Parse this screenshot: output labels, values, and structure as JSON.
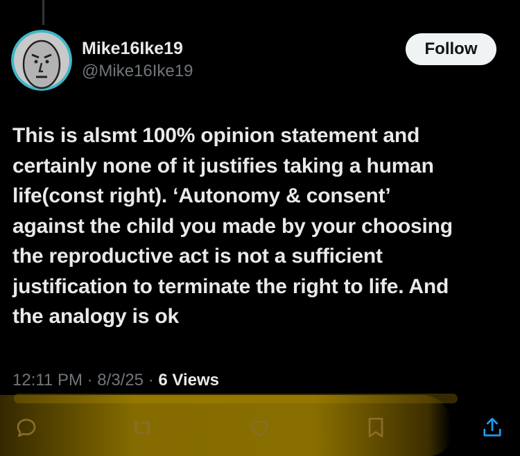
{
  "author": {
    "display_name": "Mike16Ike19",
    "handle": "@Mike16Ike19"
  },
  "follow_button": {
    "label": "Follow"
  },
  "post": {
    "text_lines": [
      "This is alsmt 100% opinion statement and",
      "certainly none of it justifies taking a human",
      "life(const right). ‘Autonomy & consent’",
      "against the child you made by your choosing",
      "the reproductive act is not a sufficient",
      "justification to terminate the right to life. And",
      "the analogy is ok"
    ]
  },
  "meta": {
    "time": "12:11 PM",
    "separator": "·",
    "date": "8/3/25",
    "views_count": "6",
    "views_label": "Views"
  },
  "actions": [
    {
      "name": "reply",
      "icon": "reply-icon"
    },
    {
      "name": "repost",
      "icon": "repost-icon"
    },
    {
      "name": "like",
      "icon": "heart-icon"
    },
    {
      "name": "bookmark",
      "icon": "bookmark-icon"
    },
    {
      "name": "share",
      "icon": "share-icon"
    }
  ],
  "colors": {
    "background": "#000000",
    "text_primary": "#e7e9ea",
    "text_secondary": "#71767b",
    "follow_bg": "#eff3f4",
    "follow_text": "#0f1419",
    "highlight": "#b8960c",
    "avatar_ring": "#3fb6c9"
  }
}
